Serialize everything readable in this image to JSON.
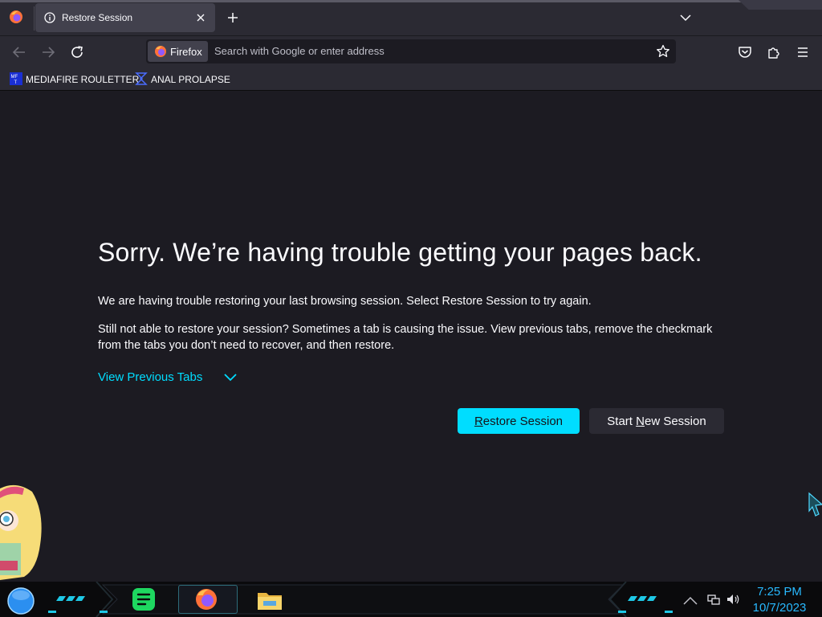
{
  "browser": {
    "tab": {
      "title": "Restore Session"
    },
    "urlbar": {
      "identity_label": "Firefox",
      "placeholder": "Search with Google or enter address"
    },
    "bookmarks": [
      {
        "label": "MEDIAFIRE ROULETTER",
        "icon": "mediafire-favicon"
      },
      {
        "label": "ANAL PROLAPSE",
        "icon": "sigma-favicon"
      }
    ]
  },
  "content": {
    "title": "Sorry. We’re having trouble getting your pages back.",
    "paragraph1": "We are having trouble restoring your last browsing session. Select Restore Session to try again.",
    "paragraph2": "Still not able to restore your session? Sometimes a tab is causing the issue. View previous tabs, remove the checkmark from the tabs you don’t need to recover, and then restore.",
    "view_tabs_label": "View Previous Tabs",
    "restore_button": {
      "u": "R",
      "rest": "estore Session"
    },
    "new_session_button": {
      "before": "Start ",
      "u": "N",
      "after": "ew Session"
    }
  },
  "taskbar": {
    "apps": [
      "spotify",
      "firefox",
      "file-explorer"
    ],
    "clock": {
      "time": "7:25 PM",
      "date": "10/7/2023"
    }
  },
  "colors": {
    "accent": "#00ddff",
    "background": "#1c1b22",
    "toolbar": "#2b2a33",
    "clock": "#28b9ff"
  }
}
